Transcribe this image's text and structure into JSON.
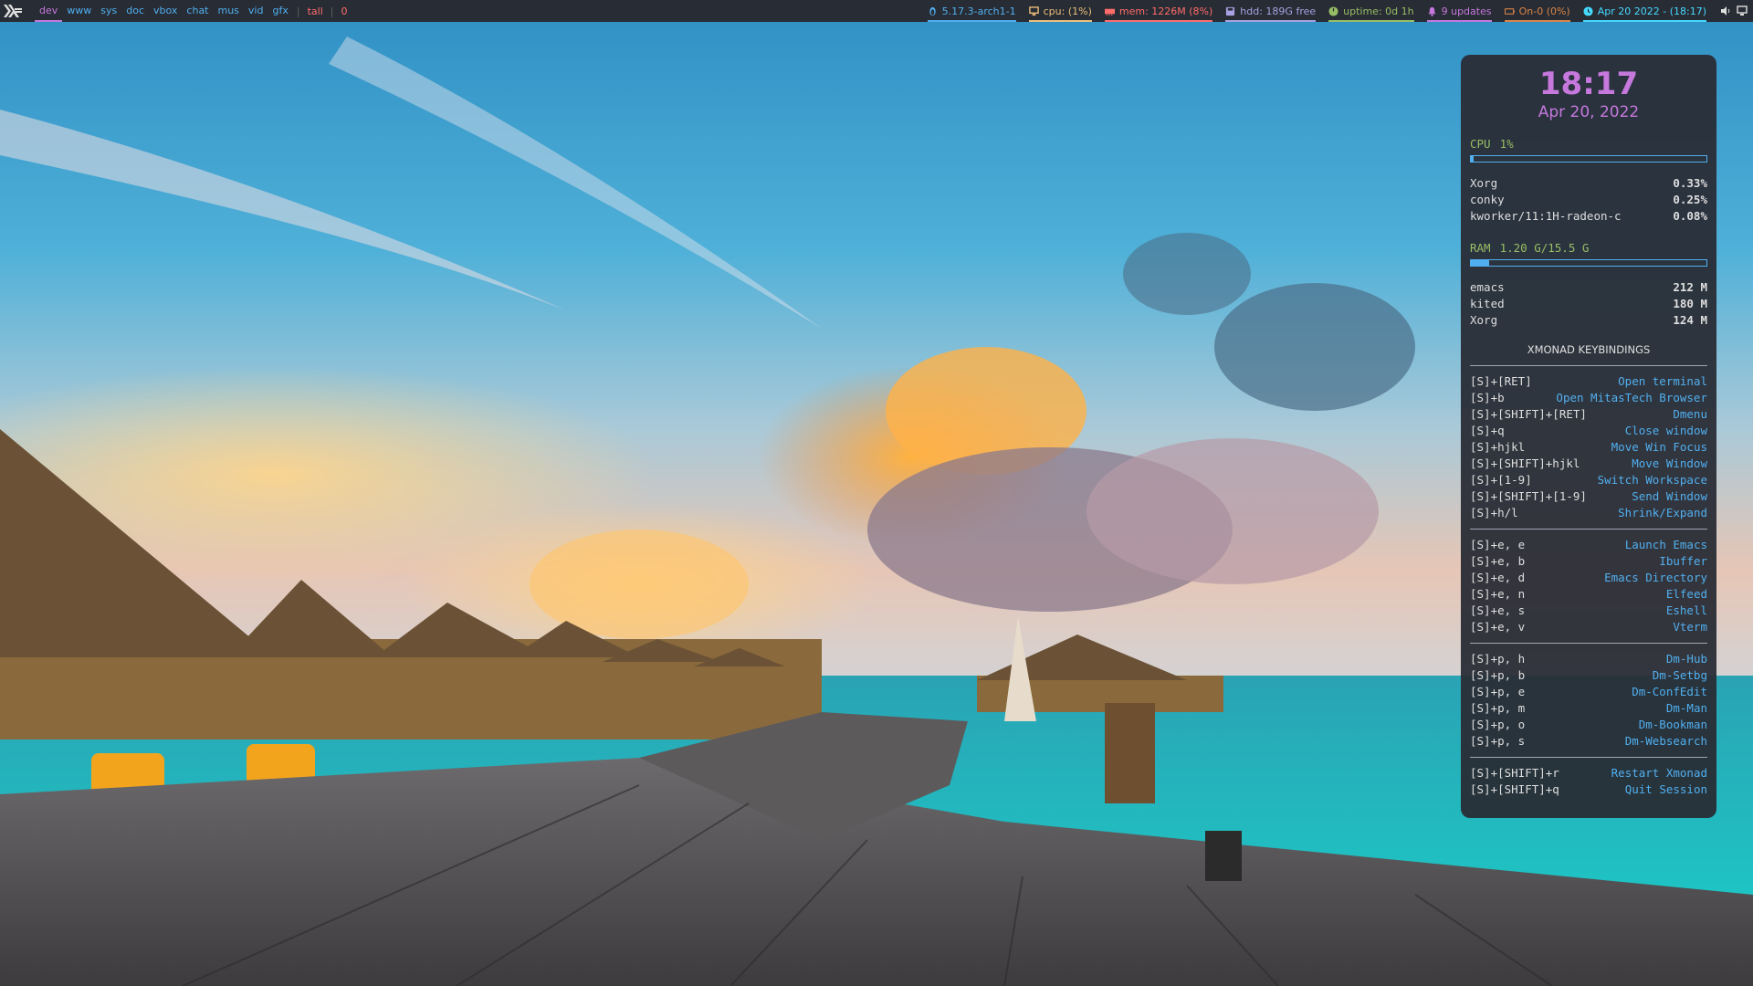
{
  "topbar": {
    "workspaces": [
      "dev",
      "www",
      "sys",
      "doc",
      "vbox",
      "chat",
      "mus",
      "vid",
      "gfx"
    ],
    "active_workspace": "dev",
    "separator": "|",
    "layout": "tall",
    "window_count": "0",
    "status": {
      "kernel": "5.17.3-arch1-1",
      "cpu": "cpu: (1%)",
      "mem": "mem: 1226M (8%)",
      "hdd": "hdd: 189G free",
      "uptime": "uptime: 0d 1h",
      "updates": "9 updates",
      "battery": "On-0 (0%)",
      "datetime": "Apr 20 2022 - (18:17)"
    },
    "status_colors": {
      "kernel": "#51afef",
      "cpu": "#ecbe7b",
      "mem": "#ff6c6b",
      "hdd": "#a9a1e1",
      "uptime": "#98be65",
      "updates": "#c678dd",
      "battery": "#da8548",
      "datetime": "#46d9ff"
    },
    "status_icons": {
      "kernel": "penguin-icon",
      "cpu": "monitor-icon",
      "mem": "memory-icon",
      "hdd": "disk-icon",
      "uptime": "power-icon",
      "updates": "bell-icon",
      "battery": "battery-icon",
      "datetime": "clock-icon"
    },
    "tray_icons": [
      "volume-icon",
      "display-icon"
    ]
  },
  "conky": {
    "time": "18:17",
    "date": "Apr 20, 2022",
    "cpu": {
      "label": "CPU",
      "value": "1%",
      "fraction": 0.01
    },
    "cpu_procs": [
      {
        "name": "Xorg",
        "value": "0.33%"
      },
      {
        "name": "conky",
        "value": "0.25%"
      },
      {
        "name": "kworker/11:1H-radeon-c",
        "value": "0.08%"
      }
    ],
    "ram": {
      "label": "RAM",
      "value": "1.20 G/15.5 G",
      "fraction": 0.077
    },
    "ram_procs": [
      {
        "name": "emacs",
        "value": "212 M"
      },
      {
        "name": "kited",
        "value": "180 M"
      },
      {
        "name": "Xorg",
        "value": "124 M"
      }
    ],
    "keybindings_title": "XMONAD KEYBINDINGS",
    "keybinding_groups": [
      [
        {
          "key": "[S]+[RET]",
          "action": "Open terminal"
        },
        {
          "key": "[S]+b",
          "action": "Open MitasTech Browser"
        },
        {
          "key": "[S]+[SHIFT]+[RET]",
          "action": "Dmenu"
        },
        {
          "key": "[S]+q",
          "action": "Close window"
        },
        {
          "key": "[S]+hjkl",
          "action": "Move Win Focus"
        },
        {
          "key": "[S]+[SHIFT]+hjkl",
          "action": "Move Window"
        },
        {
          "key": "[S]+[1-9]",
          "action": "Switch Workspace"
        },
        {
          "key": "[S]+[SHIFT]+[1-9]",
          "action": "Send Window"
        },
        {
          "key": "[S]+h/l",
          "action": "Shrink/Expand"
        }
      ],
      [
        {
          "key": "[S]+e, e",
          "action": "Launch Emacs"
        },
        {
          "key": "[S]+e, b",
          "action": "Ibuffer"
        },
        {
          "key": "[S]+e, d",
          "action": "Emacs Directory"
        },
        {
          "key": "[S]+e, n",
          "action": "Elfeed"
        },
        {
          "key": "[S]+e, s",
          "action": "Eshell"
        },
        {
          "key": "[S]+e, v",
          "action": "Vterm"
        }
      ],
      [
        {
          "key": "[S]+p, h",
          "action": "Dm-Hub"
        },
        {
          "key": "[S]+p, b",
          "action": "Dm-Setbg"
        },
        {
          "key": "[S]+p, e",
          "action": "Dm-ConfEdit"
        },
        {
          "key": "[S]+p, m",
          "action": "Dm-Man"
        },
        {
          "key": "[S]+p, o",
          "action": "Dm-Bookman"
        },
        {
          "key": "[S]+p, s",
          "action": "Dm-Websearch"
        }
      ],
      [
        {
          "key": "[S]+[SHIFT]+r",
          "action": "Restart Xmonad"
        },
        {
          "key": "[S]+[SHIFT]+q",
          "action": "Quit Session"
        }
      ]
    ]
  }
}
